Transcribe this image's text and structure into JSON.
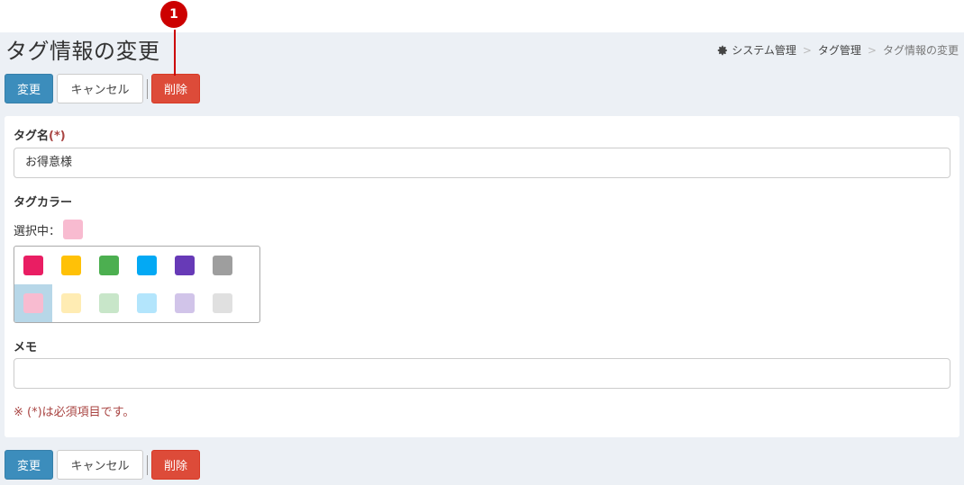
{
  "header": {
    "title": "タグ情報の変更",
    "breadcrumb": [
      {
        "label": "システム管理"
      },
      {
        "label": "タグ管理"
      },
      {
        "label": "タグ情報の変更"
      }
    ],
    "breadcrumb_separator": ">"
  },
  "toolbar": {
    "update_label": "変更",
    "cancel_label": "キャンセル",
    "delete_label": "削除"
  },
  "form": {
    "tag_name_label": "タグ名",
    "required_mark": "(*)",
    "tag_name_value": "お得意様",
    "tag_color_label": "タグカラー",
    "selected_label": "選択中：",
    "selected_color": "#f8bbd0",
    "memo_label": "メモ",
    "memo_value": "",
    "required_note": "※ (*)は必須項目です。"
  },
  "palette": {
    "row1": [
      "#e91e63",
      "#ffc107",
      "#4caf50",
      "#03a9f4",
      "#673ab7",
      "#9e9e9e"
    ],
    "row2": [
      "#f8bbd0",
      "#ffecb3",
      "#c8e6c9",
      "#b3e5fc",
      "#d1c4e9",
      "#e0e0e0"
    ],
    "selected_row": 2,
    "selected_index": 0,
    "active_cell_color": "#b7d7e8"
  },
  "annotation": {
    "number": "1",
    "color": "#cc0000"
  },
  "colors": {
    "primary": "#3c8dbc",
    "danger": "#dd4b39",
    "background": "#ecf0f5",
    "required": "#a94442"
  }
}
